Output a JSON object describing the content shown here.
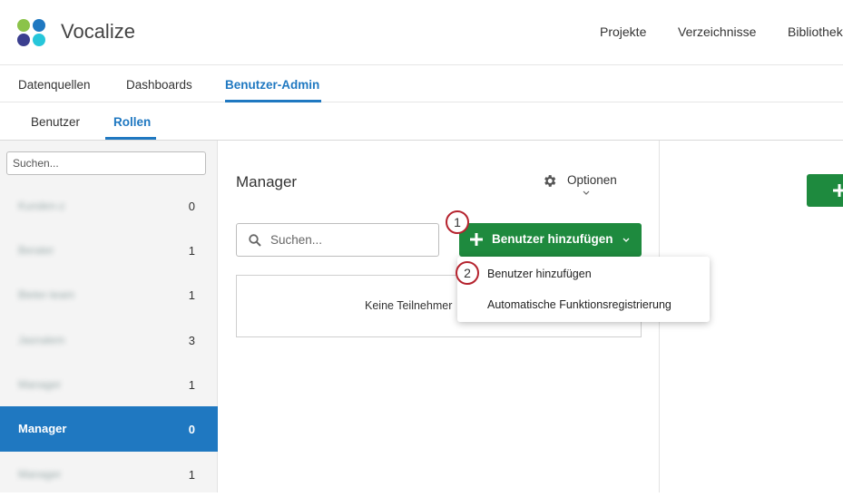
{
  "app": {
    "name": "Vocalize"
  },
  "topnav": [
    {
      "label": "Projekte"
    },
    {
      "label": "Verzeichnisse"
    },
    {
      "label": "Bibliothek"
    }
  ],
  "tabs": [
    {
      "label": "Datenquellen"
    },
    {
      "label": "Dashboards"
    },
    {
      "label": "Benutzer-Admin"
    }
  ],
  "subtabs": [
    {
      "label": "Benutzer"
    },
    {
      "label": "Rollen"
    }
  ],
  "sidebar": {
    "search_placeholder": "Suchen...",
    "roles": [
      {
        "name": "Kunden-z",
        "count": "0"
      },
      {
        "name": "Berater",
        "count": "1"
      },
      {
        "name": "Bieter-team",
        "count": "1"
      },
      {
        "name": "Jasnalem",
        "count": "3"
      },
      {
        "name": "Manager",
        "count": "1"
      },
      {
        "name": "Manager",
        "count": "0"
      },
      {
        "name": "Manager",
        "count": "1"
      }
    ]
  },
  "main": {
    "title": "Manager",
    "options_label": "Optionen",
    "search_placeholder": "Suchen...",
    "add_button_label": "Benutzer hinzufügen",
    "empty_text": "Keine Teilnehmer"
  },
  "dropdown": {
    "items": [
      {
        "label": "Benutzer hinzufügen"
      },
      {
        "label": "Automatische Funktionsregistrierung"
      }
    ]
  },
  "annotations": [
    {
      "number": "1"
    },
    {
      "number": "2"
    }
  ],
  "colors": {
    "accent": "#1f78c1",
    "green": "#1e8a3e",
    "annotation": "#b5232e",
    "logo": [
      "#8bc34a",
      "#1f78c1",
      "#3b3f8f",
      "#26c6da"
    ]
  }
}
